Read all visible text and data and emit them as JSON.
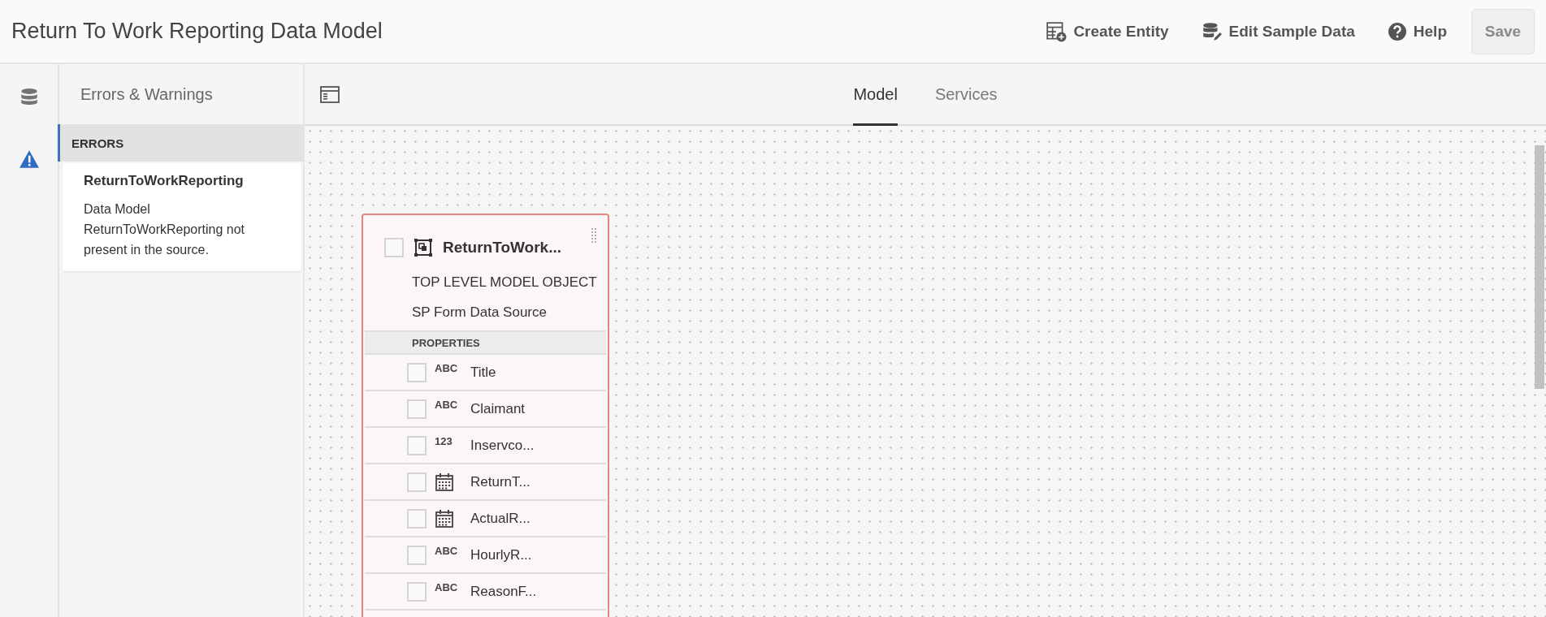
{
  "title": "Return To Work Reporting Data Model",
  "actions": [
    {
      "kind": "create",
      "label": "Create Entity"
    },
    {
      "kind": "edit",
      "label": "Edit Sample Data"
    },
    {
      "kind": "help",
      "label": "Help"
    }
  ],
  "save": {
    "label": "Save",
    "disabled": true
  },
  "rail": [
    {
      "kind": "database",
      "selected": false
    },
    {
      "kind": "warning",
      "selected": true
    }
  ],
  "panel": {
    "title": "Errors & Warnings",
    "section": "ERRORS",
    "errors": [
      {
        "name": "ReturnToWorkReporting",
        "message": "Data Model ReturnToWorkReporting not present in the source."
      }
    ]
  },
  "tabs": [
    {
      "label": "Model",
      "selected": true
    },
    {
      "label": "Services",
      "selected": false
    }
  ],
  "entity": {
    "name": "ReturnToWork...",
    "checked": false,
    "subtitle": "TOP LEVEL MODEL OBJECT",
    "source": "SP Form Data Source",
    "section": "PROPERTIES",
    "properties": [
      {
        "kind": "text",
        "type_label": "ABC",
        "name": "Title",
        "checked": false
      },
      {
        "kind": "text",
        "type_label": "ABC",
        "name": "Claimant",
        "checked": false
      },
      {
        "kind": "number",
        "type_label": "123",
        "name": "Inservco...",
        "checked": false
      },
      {
        "kind": "date",
        "name": "ReturnT...",
        "checked": false
      },
      {
        "kind": "date",
        "name": "ActualR...",
        "checked": false
      },
      {
        "kind": "text",
        "type_label": "ABC",
        "name": "HourlyR...",
        "checked": false
      },
      {
        "kind": "text",
        "type_label": "ABC",
        "name": "ReasonF...",
        "checked": false
      }
    ]
  }
}
